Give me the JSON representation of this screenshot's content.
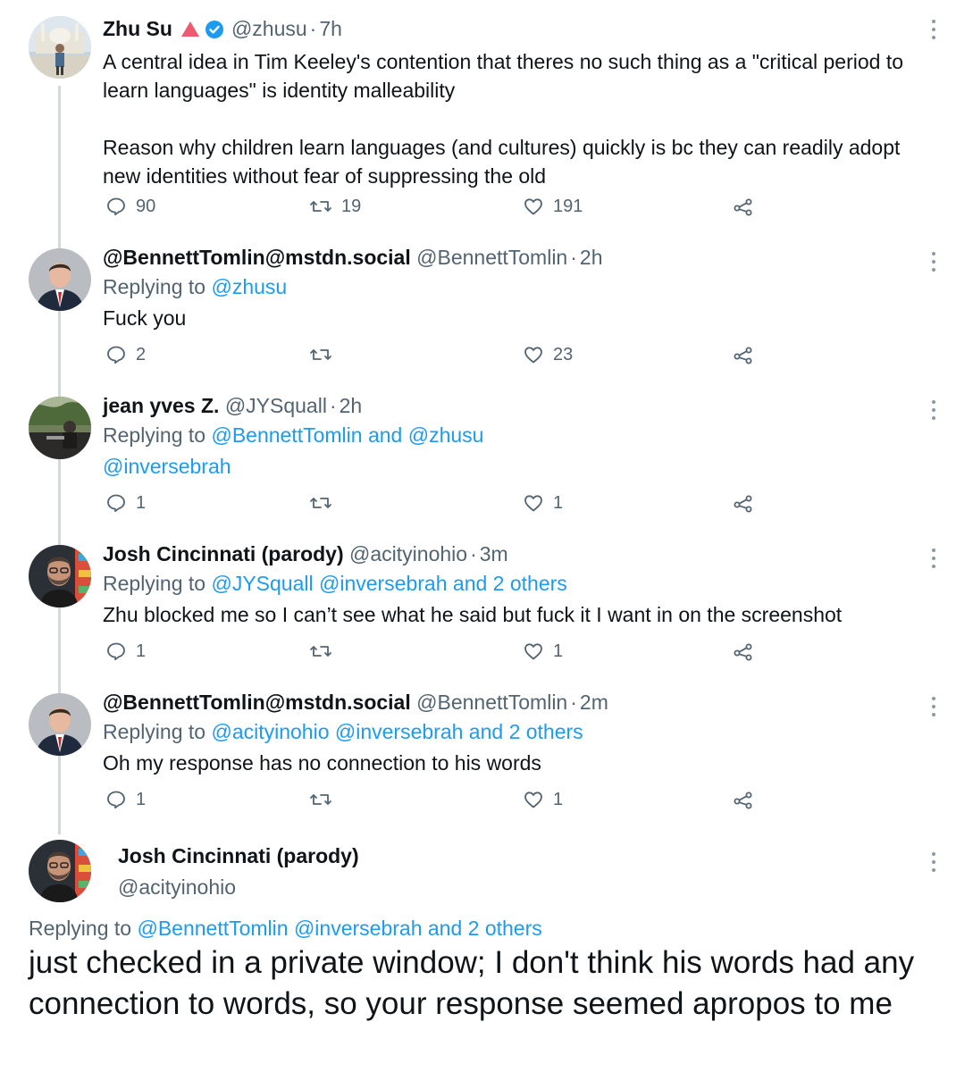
{
  "colors": {
    "link": "#1d9bf0",
    "secondary_text": "#536471",
    "primary_text": "#0f1419",
    "thread_line": "#cfd9de",
    "red_badge": "#ee5a6f",
    "verified": "#1d9bf0"
  },
  "tweets": [
    {
      "name": "Zhu Su",
      "badges": [
        "red-triangle-icon",
        "verified-badge-icon"
      ],
      "handle": "@zhusu",
      "time": "7h",
      "text_lines": [
        "A central idea in Tim Keeley's contention that theres no such thing as a \"critical period to learn languages\" is identity malleability",
        "Reason why children learn languages (and cultures) quickly is bc they can readily adopt new identities without fear of suppressing the old"
      ],
      "replies": "90",
      "retweets": "19",
      "likes": "191"
    },
    {
      "name": "@BennettTomlin@mstdn.social",
      "handle": "@BennettTomlin",
      "time": "2h",
      "replying_prefix": "Replying to",
      "replying_to": "@zhusu",
      "text": "Fuck you",
      "replies": "2",
      "retweets": "",
      "likes": "23"
    },
    {
      "name": "jean yves Z.",
      "handle": "@JYSquall",
      "time": "2h",
      "replying_prefix": "Replying to",
      "replying_to": "@BennettTomlin and @zhusu",
      "text": "@inversebrah",
      "replies": "1",
      "retweets": "",
      "likes": "1"
    },
    {
      "name": "Josh Cincinnati (parody)",
      "handle": "@acityinohio",
      "time": "3m",
      "replying_prefix": "Replying to",
      "replying_to": "@JYSquall @inversebrah and 2 others",
      "text": "Zhu blocked me so I can’t see what he said but fuck it I want in on the screenshot",
      "replies": "1",
      "retweets": "",
      "likes": "1"
    },
    {
      "name": "@BennettTomlin@mstdn.social",
      "handle": "@BennettTomlin",
      "time": "2m",
      "replying_prefix": "Replying to",
      "replying_to": "@acityinohio @inversebrah and 2 others",
      "text": "Oh my response has no connection to his words",
      "replies": "1",
      "retweets": "",
      "likes": "1"
    }
  ],
  "final_tweet": {
    "name": "Josh Cincinnati (parody)",
    "handle": "@acityinohio",
    "replying_prefix": "Replying to",
    "replying_to": "@BennettTomlin @inversebrah and 2 others",
    "text": "just checked in a private window; I don't think his words had any connection to words, so your response seemed apropos to me"
  }
}
